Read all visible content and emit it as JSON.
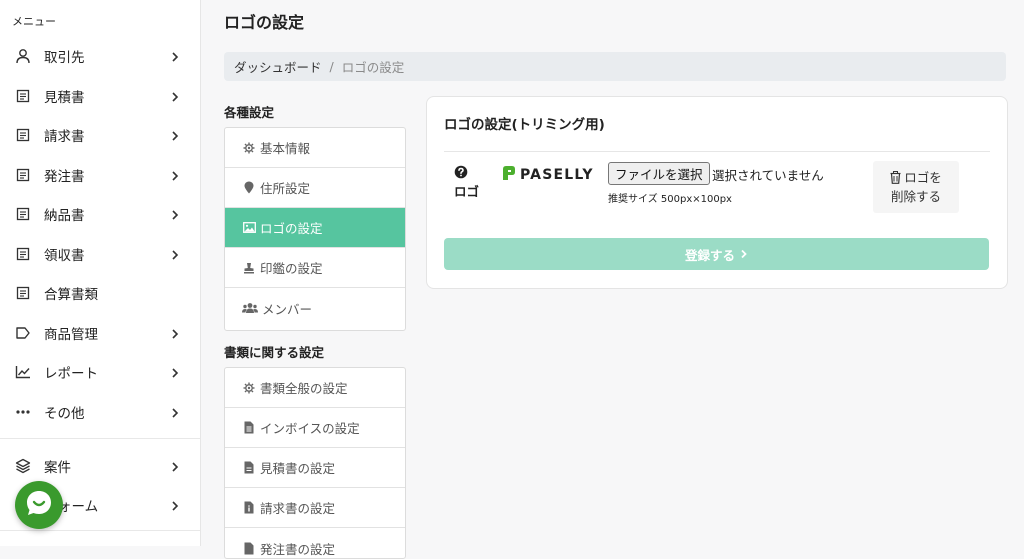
{
  "sidebar": {
    "menu_title": "メニュー",
    "items": [
      {
        "label": "取引先",
        "icon": "person-icon",
        "has_chevron": true
      },
      {
        "label": "見積書",
        "icon": "document-icon",
        "has_chevron": true
      },
      {
        "label": "請求書",
        "icon": "document-icon",
        "has_chevron": true
      },
      {
        "label": "発注書",
        "icon": "document-icon",
        "has_chevron": true
      },
      {
        "label": "納品書",
        "icon": "document-icon",
        "has_chevron": true
      },
      {
        "label": "領収書",
        "icon": "document-icon",
        "has_chevron": true
      },
      {
        "label": "合算書類",
        "icon": "document-icon",
        "has_chevron": false
      },
      {
        "label": "商品管理",
        "icon": "tag-icon",
        "has_chevron": true
      },
      {
        "label": "レポート",
        "icon": "chart-icon",
        "has_chevron": true
      },
      {
        "label": "その他",
        "icon": "ellipsis-icon",
        "has_chevron": true
      },
      {
        "label": "案件",
        "icon": "layers-icon",
        "has_chevron": true
      },
      {
        "label": "ォーム",
        "icon": "form-icon",
        "has_chevron": true
      }
    ]
  },
  "header": {
    "title": "ロゴの設定"
  },
  "breadcrumb": {
    "home": "ダッシュボード",
    "separator": "/",
    "current": "ロゴの設定"
  },
  "settings_nav": {
    "general_title": "各種設定",
    "general_items": [
      {
        "label": "基本情報",
        "icon": "gear-icon",
        "active": false
      },
      {
        "label": "住所設定",
        "icon": "map-pin-icon",
        "active": false
      },
      {
        "label": "ロゴの設定",
        "icon": "image-icon",
        "active": true
      },
      {
        "label": "印鑑の設定",
        "icon": "stamp-icon",
        "active": false
      },
      {
        "label": "メンバー",
        "icon": "users-icon",
        "active": false
      }
    ],
    "docs_title": "書類に関する設定",
    "doc_items": [
      {
        "label": "書類全般の設定",
        "icon": "gear-icon"
      },
      {
        "label": "インボイスの設定",
        "icon": "file-icon"
      },
      {
        "label": "見積書の設定",
        "icon": "file-icon"
      },
      {
        "label": "請求書の設定",
        "icon": "file-info-icon"
      },
      {
        "label": "発注書の設定",
        "icon": "file-icon"
      }
    ]
  },
  "logo_card": {
    "title": "ロゴの設定(トリミング用)",
    "field_label": "ロゴ",
    "brand_name": "PASELLY",
    "file_button": "ファイルを選択",
    "file_status": "選択されていません",
    "recommended_size": "推奨サイズ 500px×100px",
    "delete_line1": "ロゴを",
    "delete_line2": "削除する",
    "submit_label": "登録する"
  },
  "colors": {
    "accent": "#56c59f",
    "submit_disabled": "#9bdcc6",
    "brand_green": "#3a9a2d"
  }
}
